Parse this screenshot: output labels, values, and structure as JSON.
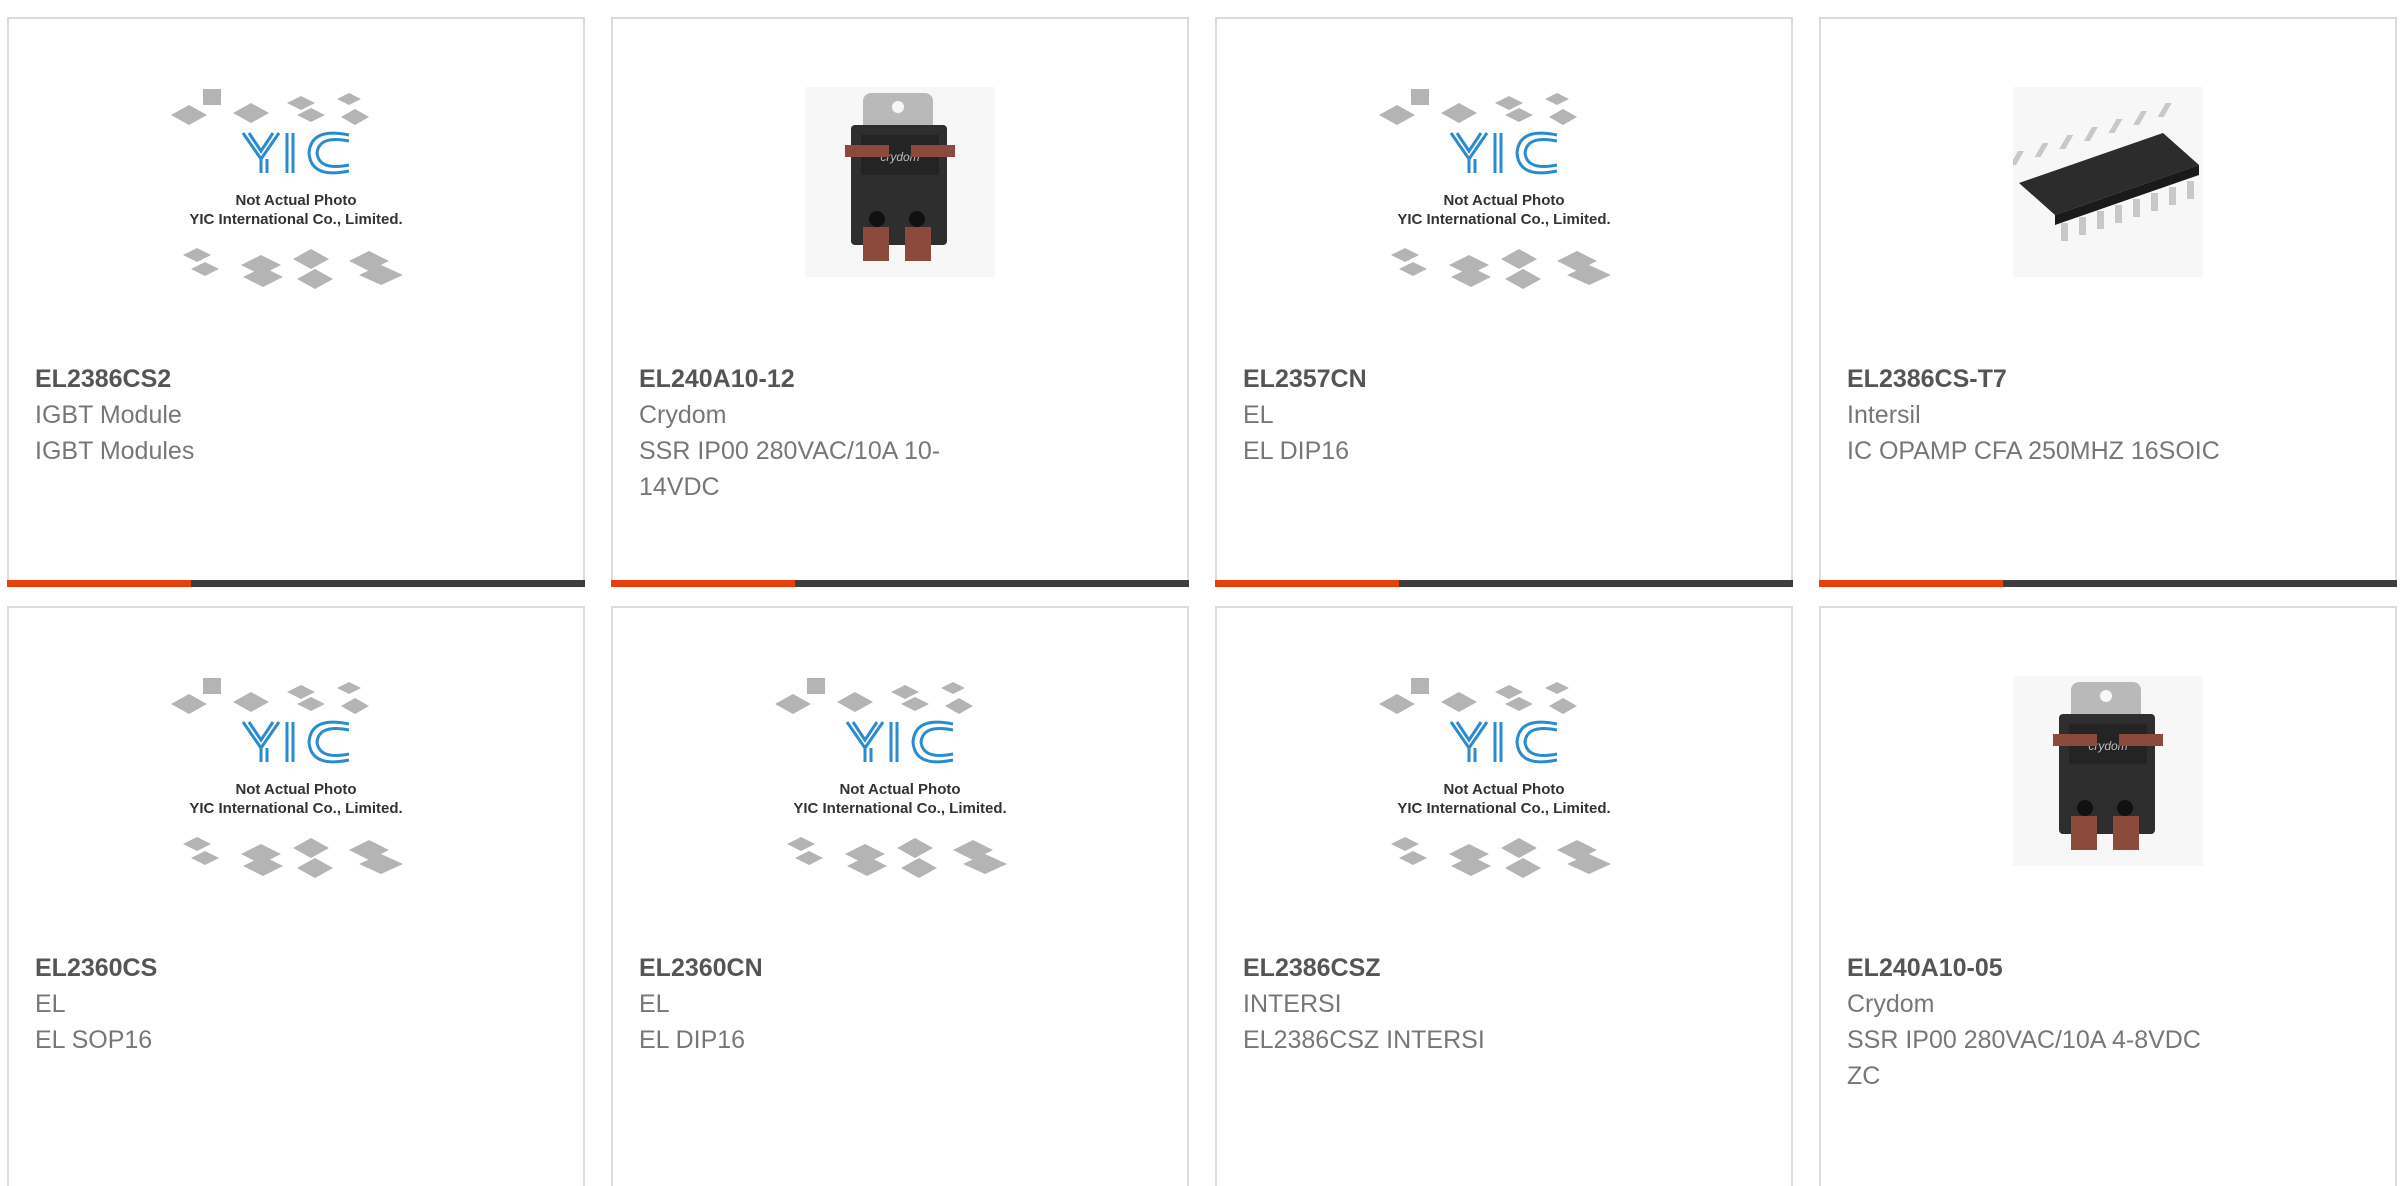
{
  "colors": {
    "accent": "#e8400c",
    "bar": "#3e3e3e",
    "border": "#dcdcdc",
    "title": "#555555",
    "text": "#777777",
    "logo": "#2a8ccf"
  },
  "placeholder": {
    "line1": "Not Actual Photo",
    "line2": "YIC International Co., Limited.",
    "logo_text": "YIC"
  },
  "relay_label": "crydom",
  "products": [
    {
      "part": "EL2386CS2",
      "brand": "IGBT Module",
      "desc": "IGBT Modules",
      "image": "placeholder-icon"
    },
    {
      "part": "EL240A10-12",
      "brand": "Crydom",
      "desc": "SSR IP00 280VAC/10A 10-14VDC",
      "image": "relay-icon"
    },
    {
      "part": "EL2357CN",
      "brand": "EL",
      "desc": "EL DIP16",
      "image": "placeholder-icon"
    },
    {
      "part": "EL2386CS-T7",
      "brand": "Intersil",
      "desc": "IC OPAMP CFA 250MHZ 16SOIC",
      "image": "soic-chip-icon"
    },
    {
      "part": "EL2360CS",
      "brand": "EL",
      "desc": "EL SOP16",
      "image": "placeholder-icon"
    },
    {
      "part": "EL2360CN",
      "brand": "EL",
      "desc": "EL DIP16",
      "image": "placeholder-icon"
    },
    {
      "part": "EL2386CSZ",
      "brand": "INTERSI",
      "desc": "EL2386CSZ INTERSI",
      "image": "placeholder-icon"
    },
    {
      "part": "EL240A10-05",
      "brand": "Crydom",
      "desc": "SSR IP00 280VAC/10A 4-8VDC ZC",
      "image": "relay-icon"
    }
  ]
}
